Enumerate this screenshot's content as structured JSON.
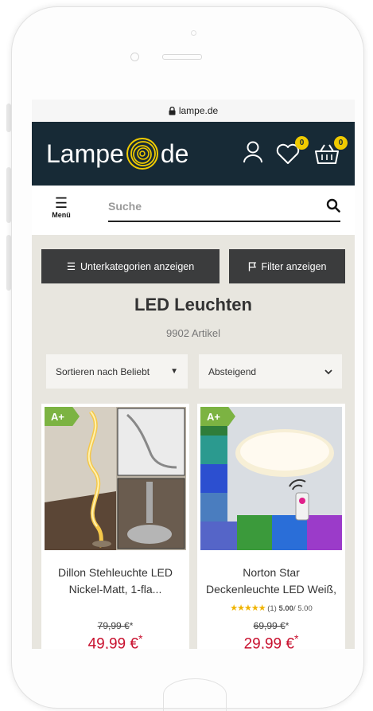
{
  "browser": {
    "url": "lampe.de"
  },
  "header": {
    "logo_left": "Lampe",
    "logo_right": "de",
    "wishlist_count": "0",
    "cart_count": "0",
    "colors": {
      "header_bg": "#172a36",
      "badge": "#f0cb00"
    }
  },
  "search": {
    "menu_label": "Menü",
    "placeholder": "Suche"
  },
  "actions": {
    "subcategories_label": "Unterkategorien anzeigen",
    "filter_label": "Filter anzeigen"
  },
  "category": {
    "title": "LED Leuchten",
    "count": "9902 Artikel"
  },
  "sorting": {
    "sort_label": "Sortieren nach Beliebt",
    "order_label": "Absteigend"
  },
  "products": [
    {
      "energy_class": "A+",
      "name_line1": "Dillon Stehleuchte LED",
      "name_line2": "Nickel-Matt, 1-fla...",
      "old_price": "79,99 €",
      "old_price_mark": "*",
      "price": "49,99 €",
      "price_mark": "*"
    },
    {
      "energy_class": "A+",
      "name_line1": "Norton Star",
      "name_line2": "Deckenleuchte LED Weiß,",
      "rating_stars": "★★★★★",
      "rating_value": 5.0,
      "rating_count": "(1)",
      "rating_score": "5.00",
      "rating_max": "/ 5.00",
      "old_price": "69,99 €",
      "old_price_mark": "*",
      "price": "29,99 €",
      "price_mark": "*"
    }
  ]
}
